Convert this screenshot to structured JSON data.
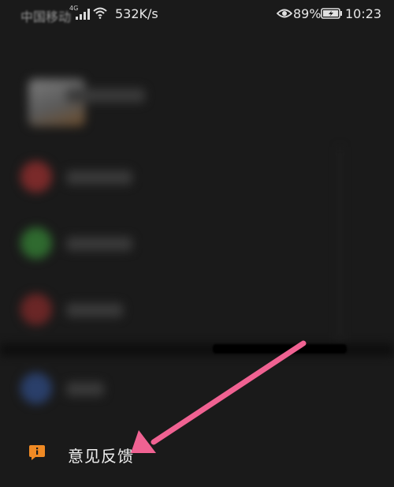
{
  "status_bar": {
    "carrier": "中国移动",
    "network_type": "4G",
    "speed": "532K/s",
    "battery_percent": "89%",
    "time": "10:23",
    "icons": [
      "signal-icon",
      "wifi-icon",
      "eye-icon",
      "battery-charging-icon"
    ]
  },
  "menu": {
    "feedback": {
      "label": "意见反馈",
      "icon": "feedback-chat-icon",
      "icon_color": "#f08a24"
    }
  },
  "annotation": {
    "arrow_color": "#f06292"
  }
}
